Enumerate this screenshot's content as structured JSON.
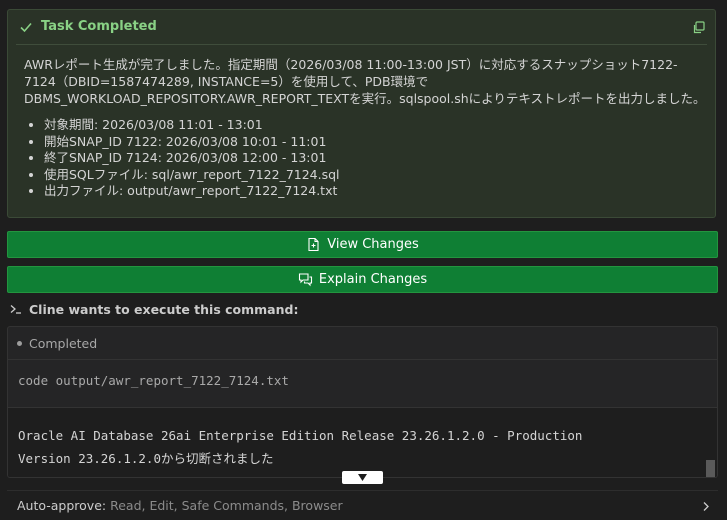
{
  "task": {
    "title": "Task Completed",
    "paragraph": "AWRレポート生成が完了しました。指定期間（2026/03/08 11:00-13:00 JST）に対応するスナップショット7122-7124（DBID=1587474289, INSTANCE=5）を使用して、PDB環境でDBMS_WORKLOAD_REPOSITORY.AWR_REPORT_TEXTを実行。sqlspool.shによりテキストレポートを出力しました。",
    "items": [
      "対象期間: 2026/03/08 11:01 - 13:01",
      "開始SNAP_ID 7122: 2026/03/08 10:01 - 11:01",
      "終了SNAP_ID 7124: 2026/03/08 12:00 - 13:01",
      "使用SQLファイル: sql/awr_report_7122_7124.sql",
      "出力ファイル: output/awr_report_7122_7124.txt"
    ]
  },
  "buttons": {
    "view_changes": "View Changes",
    "explain_changes": "Explain Changes"
  },
  "command": {
    "header": "Cline wants to execute this command:",
    "status": "Completed",
    "code": "code output/awr_report_7122_7124.txt",
    "output": [
      "Oracle AI Database 26ai Enterprise Edition Release 23.26.1.2.0 - Production",
      "Version 23.26.1.2.0から切断されました"
    ]
  },
  "auto_approve": {
    "label": "Auto-approve:",
    "list": "Read, Edit, Safe Commands, Browser"
  },
  "colors": {
    "success_green": "#89d185",
    "button_green": "#0f7f34",
    "background": "#1e1e1e"
  },
  "icons": [
    "check-icon",
    "copy-icon",
    "file-diff-icon",
    "comment-discussion-icon",
    "terminal-icon",
    "triangle-down-icon",
    "chevron-right-icon"
  ]
}
